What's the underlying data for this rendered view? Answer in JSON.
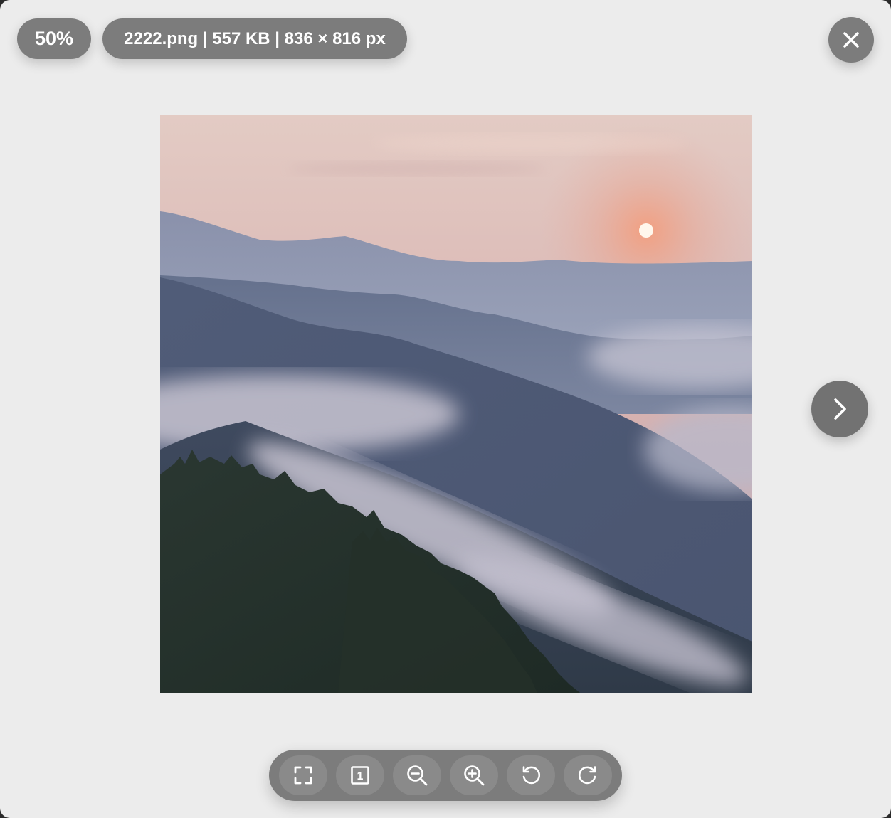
{
  "zoom": {
    "level": "50%"
  },
  "file_info": {
    "text": "2222.png | 557 KB | 836 × 816 px"
  },
  "icons": {
    "close": "close-icon",
    "next": "chevron-right-icon",
    "toolbar": [
      "fullscreen-icon",
      "actual-size-icon",
      "zoom-out-icon",
      "zoom-in-icon",
      "rotate-left-icon",
      "rotate-right-icon"
    ]
  },
  "toolbar": {
    "actual_size_glyph": "1"
  },
  "colors": {
    "backdrop": "#ececec",
    "control": "#7c7c7c",
    "icon": "#ffffff"
  }
}
